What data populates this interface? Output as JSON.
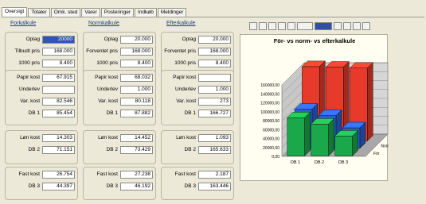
{
  "tabs": [
    "Oversigt",
    "Totaler",
    "Omk. sted",
    "Varer",
    "Posteringer",
    "Indkøb",
    "Meldinger"
  ],
  "columns": [
    {
      "header": "Forkalkule",
      "groups": [
        [
          [
            "Oplag",
            "20000"
          ],
          [
            "Tilbudt pris",
            "168.000"
          ],
          [
            "1000 pris",
            "8.400"
          ],
          [
            "Salgspris",
            "158.570"
          ]
        ],
        [
          [
            "Papir kost",
            "67.915"
          ],
          [
            "Underlev",
            ""
          ],
          [
            "Var. kost",
            "82.546"
          ],
          [
            "DB 1",
            "85.454"
          ]
        ],
        [
          [
            "Løn kost",
            "14.303"
          ],
          [
            "DB 2",
            "71.151"
          ]
        ],
        [
          [
            "Fast kost",
            "26.754"
          ],
          [
            "DB 3",
            "44.397"
          ]
        ]
      ]
    },
    {
      "header": "Normkalkule",
      "groups": [
        [
          [
            "Oplag",
            "20.000"
          ],
          [
            "Forventet pris",
            "168.000"
          ],
          [
            "1000 pris",
            "8.400"
          ],
          [
            "Salgspris",
            "153.303"
          ]
        ],
        [
          [
            "Papir kost",
            "68.032"
          ],
          [
            "Underlev",
            "1.000"
          ],
          [
            "Var. kost",
            "80.118"
          ],
          [
            "DB 1",
            "87.882"
          ]
        ],
        [
          [
            "Løn kost",
            "14.452"
          ],
          [
            "DB 2",
            "73.429"
          ]
        ],
        [
          [
            "Fast kost",
            "27.238"
          ],
          [
            "DB 3",
            "46.192"
          ]
        ]
      ]
    },
    {
      "header": "Efterkalkule",
      "groups": [
        [
          [
            "Oplag",
            "20.000"
          ],
          [
            "Forventet pris",
            "168.000"
          ],
          [
            "1000 pris",
            "8.400"
          ],
          [
            "Salgspris",
            "6.314"
          ]
        ],
        [
          [
            "Papir kost",
            ""
          ],
          [
            "Underlev",
            "1.000"
          ],
          [
            "Var. kost",
            "273"
          ],
          [
            "DB 1",
            "166.727"
          ]
        ],
        [
          [
            "Løn kost",
            "1.093"
          ],
          [
            "DB 2",
            "165.633"
          ]
        ],
        [
          [
            "Fast kost",
            "2.187"
          ],
          [
            "DB 3",
            "163.446"
          ]
        ]
      ]
    }
  ],
  "chart_data": {
    "type": "bar",
    "title": "För- vs norm- vs efterkalkule",
    "categories": [
      "DB 1",
      "DB 2",
      "DB 3"
    ],
    "series": [
      {
        "name": "För",
        "values": [
          85454,
          71151,
          44397
        ],
        "color": "#1aa84a"
      },
      {
        "name": "Norm",
        "values": [
          87882,
          73429,
          46192
        ],
        "color": "#2b5fd0"
      },
      {
        "name": "Efter",
        "values": [
          166727,
          165633,
          163446
        ],
        "color": "#e83a2a"
      }
    ],
    "yticks": [
      "0,00",
      "20000,00",
      "40000,00",
      "60000,00",
      "80000,00",
      "100000,00",
      "120000,00",
      "140000,00",
      "160000,00"
    ],
    "ylim": [
      0,
      160000
    ]
  },
  "toolbar": {
    "icons": [
      "save-icon",
      "open-icon",
      "print-icon",
      "cut-icon",
      "copy-icon",
      "chart-type-icon",
      "color-icon",
      "options-icon",
      "refresh-icon",
      "paint-icon",
      "document-icon"
    ]
  }
}
